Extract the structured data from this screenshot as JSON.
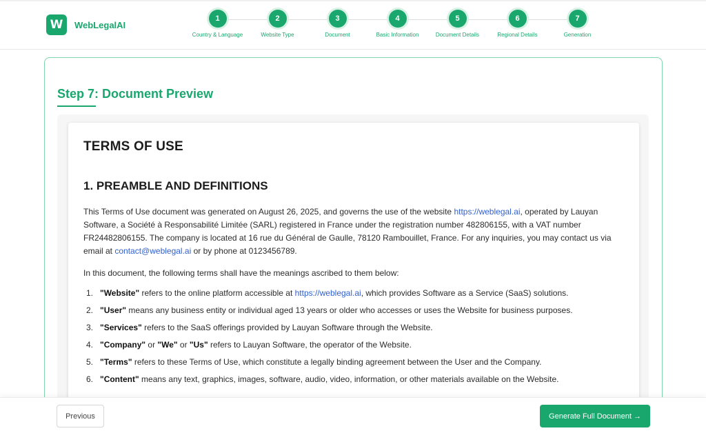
{
  "app": {
    "logo_letter": "W",
    "name": "WebLegalAI"
  },
  "stepper": {
    "steps": [
      {
        "number": "1",
        "label": "Country & Language"
      },
      {
        "number": "2",
        "label": "Website Type"
      },
      {
        "number": "3",
        "label": "Document"
      },
      {
        "number": "4",
        "label": "Basic Information"
      },
      {
        "number": "5",
        "label": "Document Details"
      },
      {
        "number": "6",
        "label": "Regional Details"
      },
      {
        "number": "7",
        "label": "Generation"
      }
    ]
  },
  "page": {
    "title": "Step 7: Document Preview"
  },
  "document": {
    "title": "TERMS OF USE",
    "section_heading": "1. PREAMBLE AND DEFINITIONS",
    "preamble": {
      "part1": "This Terms of Use document was generated on August 26, 2025, and governs the use of the website ",
      "website_link": "https://weblegal.ai",
      "part2": ", operated by Lauyan Software, a Société à Responsabilité Limitée (SARL) registered in France under the registration number 482806155, with a VAT number FR24482806155. The company is located at 16 rue du Général de Gaulle, 78120 Rambouillet, France. For any inquiries, you may contact us via email at ",
      "email_link": "contact@weblegal.ai",
      "part3": " or by phone at 0123456789."
    },
    "intro": "In this document, the following terms shall have the meanings ascribed to them below:",
    "definitions": [
      {
        "num": "1.",
        "term": "\"Website\"",
        "text_before": " refers to the online platform accessible at ",
        "link": "https://weblegal.ai",
        "text_after": ", which provides Software as a Service (SaaS) solutions."
      },
      {
        "num": "2.",
        "term": "\"User\"",
        "text": " means any business entity or individual aged 13 years or older who accesses or uses the Website for business purposes."
      },
      {
        "num": "3.",
        "term": "\"Services\"",
        "text": " refers to the SaaS offerings provided by Lauyan Software through the Website."
      },
      {
        "num": "4.",
        "term": "\"Company\"",
        "or1": " or ",
        "term2": "\"We\"",
        "or2": " or ",
        "term3": "\"Us\"",
        "text": " refers to Lauyan Software, the operator of the Website."
      },
      {
        "num": "5.",
        "term": "\"Terms\"",
        "text": " refers to these Terms of Use, which constitute a legally binding agreement between the User and the Company."
      },
      {
        "num": "6.",
        "term": "\"Content\"",
        "text": " means any text, graphics, images, software, audio, video, information, or other materials available on the Website."
      }
    ]
  },
  "footer": {
    "previous_label": "Previous",
    "generate_label": "Generate Full Document →"
  },
  "colors": {
    "accent": "#1aa76e",
    "link": "#2f5fd0",
    "card_border": "#7ed4ab"
  }
}
